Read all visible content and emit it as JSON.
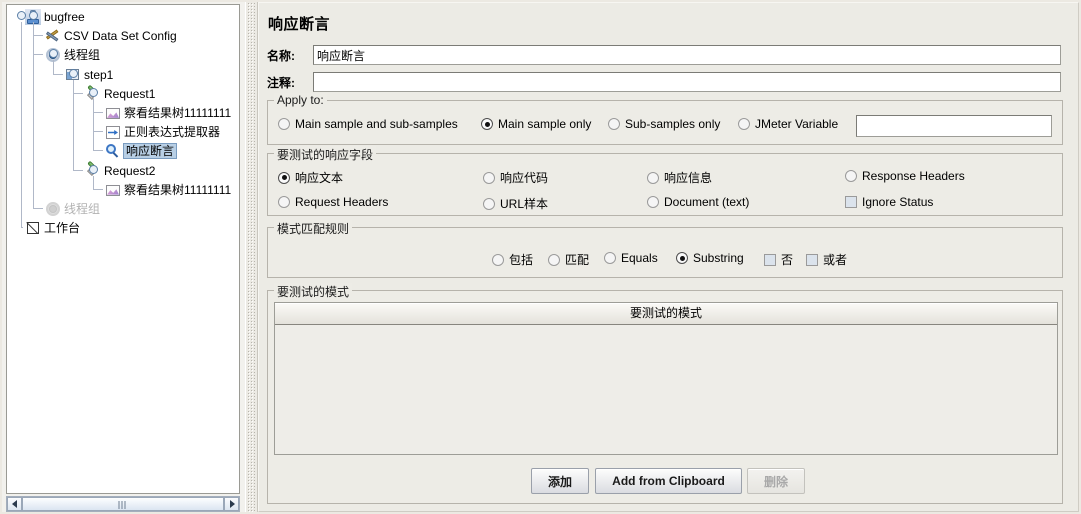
{
  "tree": {
    "nodes": [
      {
        "label": "bugfree",
        "icon": "test-plan-icon",
        "indent": 0,
        "state": "normal"
      },
      {
        "label": "CSV Data Set Config",
        "icon": "csv-config-icon",
        "indent": 1,
        "state": "normal"
      },
      {
        "label": "线程组",
        "icon": "thread-group-icon",
        "indent": 1,
        "state": "normal"
      },
      {
        "label": "step1",
        "icon": "controller-icon",
        "indent": 2,
        "state": "normal"
      },
      {
        "label": "Request1",
        "icon": "sampler-icon",
        "indent": 3,
        "state": "normal"
      },
      {
        "label": "察看结果树11111111",
        "icon": "listener-icon",
        "indent": 4,
        "state": "normal"
      },
      {
        "label": "正则表达式提取器",
        "icon": "post-processor-icon",
        "indent": 4,
        "state": "normal"
      },
      {
        "label": "响应断言",
        "icon": "assertion-icon",
        "indent": 4,
        "state": "selected"
      },
      {
        "label": "Request2",
        "icon": "sampler-icon",
        "indent": 3,
        "state": "normal"
      },
      {
        "label": "察看结果树11111111",
        "icon": "listener-icon",
        "indent": 4,
        "state": "normal"
      },
      {
        "label": "线程组",
        "icon": "thread-group-icon",
        "indent": 1,
        "state": "disabled"
      },
      {
        "label": "工作台",
        "icon": "workbench-icon",
        "indent": 0,
        "state": "normal"
      }
    ],
    "scrollbar": {
      "left_arrow": "◀",
      "right_arrow": "▶"
    }
  },
  "panel": {
    "title": "响应断言",
    "name_field": {
      "label": "名称:",
      "value": "响应断言",
      "placeholder": ""
    },
    "comment_field": {
      "label": "注释:",
      "value": "",
      "placeholder": ""
    },
    "apply_to": {
      "legend": "Apply to:",
      "options": [
        {
          "label": "Main sample and sub-samples",
          "selected": false
        },
        {
          "label": "Main sample only",
          "selected": true
        },
        {
          "label": "Sub-samples only",
          "selected": false
        },
        {
          "label": "JMeter Variable",
          "selected": false
        }
      ],
      "variable_field": {
        "value": "",
        "placeholder": ""
      }
    },
    "response_field": {
      "legend": "要测试的响应字段",
      "row1": [
        {
          "label": "响应文本",
          "type": "radio",
          "selected": true
        },
        {
          "label": "响应代码",
          "type": "radio",
          "selected": false
        },
        {
          "label": "响应信息",
          "type": "radio",
          "selected": false
        },
        {
          "label": "Response Headers",
          "type": "radio",
          "selected": false
        }
      ],
      "row2": [
        {
          "label": "Request Headers",
          "type": "radio",
          "selected": false
        },
        {
          "label": "URL样本",
          "type": "radio",
          "selected": false
        },
        {
          "label": "Document (text)",
          "type": "radio",
          "selected": false
        },
        {
          "label": "Ignore Status",
          "type": "checkbox",
          "selected": false
        }
      ]
    },
    "pattern_rules": {
      "legend": "模式匹配规则",
      "options": [
        {
          "label": "包括",
          "type": "radio",
          "selected": false
        },
        {
          "label": "匹配",
          "type": "radio",
          "selected": false
        },
        {
          "label": "Equals",
          "type": "radio",
          "selected": false
        },
        {
          "label": "Substring",
          "type": "radio",
          "selected": true
        },
        {
          "label": "否",
          "type": "checkbox",
          "selected": false
        },
        {
          "label": "或者",
          "type": "checkbox",
          "selected": false
        }
      ]
    },
    "patterns_to_test": {
      "legend": "要测试的模式",
      "column_header": "要测试的模式",
      "rows": []
    },
    "buttons": [
      {
        "label": "添加",
        "name": "add-button",
        "disabled": false
      },
      {
        "label": "Add from Clipboard",
        "name": "add-from-clipboard-button",
        "disabled": false
      },
      {
        "label": "删除",
        "name": "delete-button",
        "disabled": true
      }
    ]
  },
  "colors": {
    "selection_blue": "#b8cfe5",
    "panel_bg": "#edece6",
    "tree_bg": "#ffffff",
    "border": "#b6b3ab"
  }
}
